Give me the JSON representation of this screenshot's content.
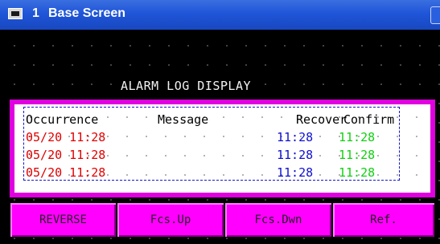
{
  "window": {
    "number": "1",
    "title": "Base Screen"
  },
  "screen": {
    "heading": "ALARM LOG DISPLAY"
  },
  "table": {
    "headers": {
      "occurrence": "Occurrence",
      "message": "Message",
      "recovery": "Recover",
      "confirm": "Confirm"
    },
    "rows": [
      {
        "occurrence": "05/20 11:28",
        "message": "",
        "recovery": "11:28",
        "confirm": "11:28"
      },
      {
        "occurrence": "05/20 11:28",
        "message": "",
        "recovery": "11:28",
        "confirm": "11:28"
      },
      {
        "occurrence": "05/20 11:28",
        "message": "",
        "recovery": "11:28",
        "confirm": "11:28"
      }
    ]
  },
  "buttons": {
    "reverse": "REVERSE",
    "fcs_up": "Fcs.Up",
    "fcs_dwn": "Fcs.Dwn",
    "ref": "Ref."
  },
  "colors": {
    "frame": "#e000e0",
    "button": "#ff00ff",
    "occurrence": "#e00000",
    "recovery": "#1010d0",
    "confirm": "#10d010"
  }
}
